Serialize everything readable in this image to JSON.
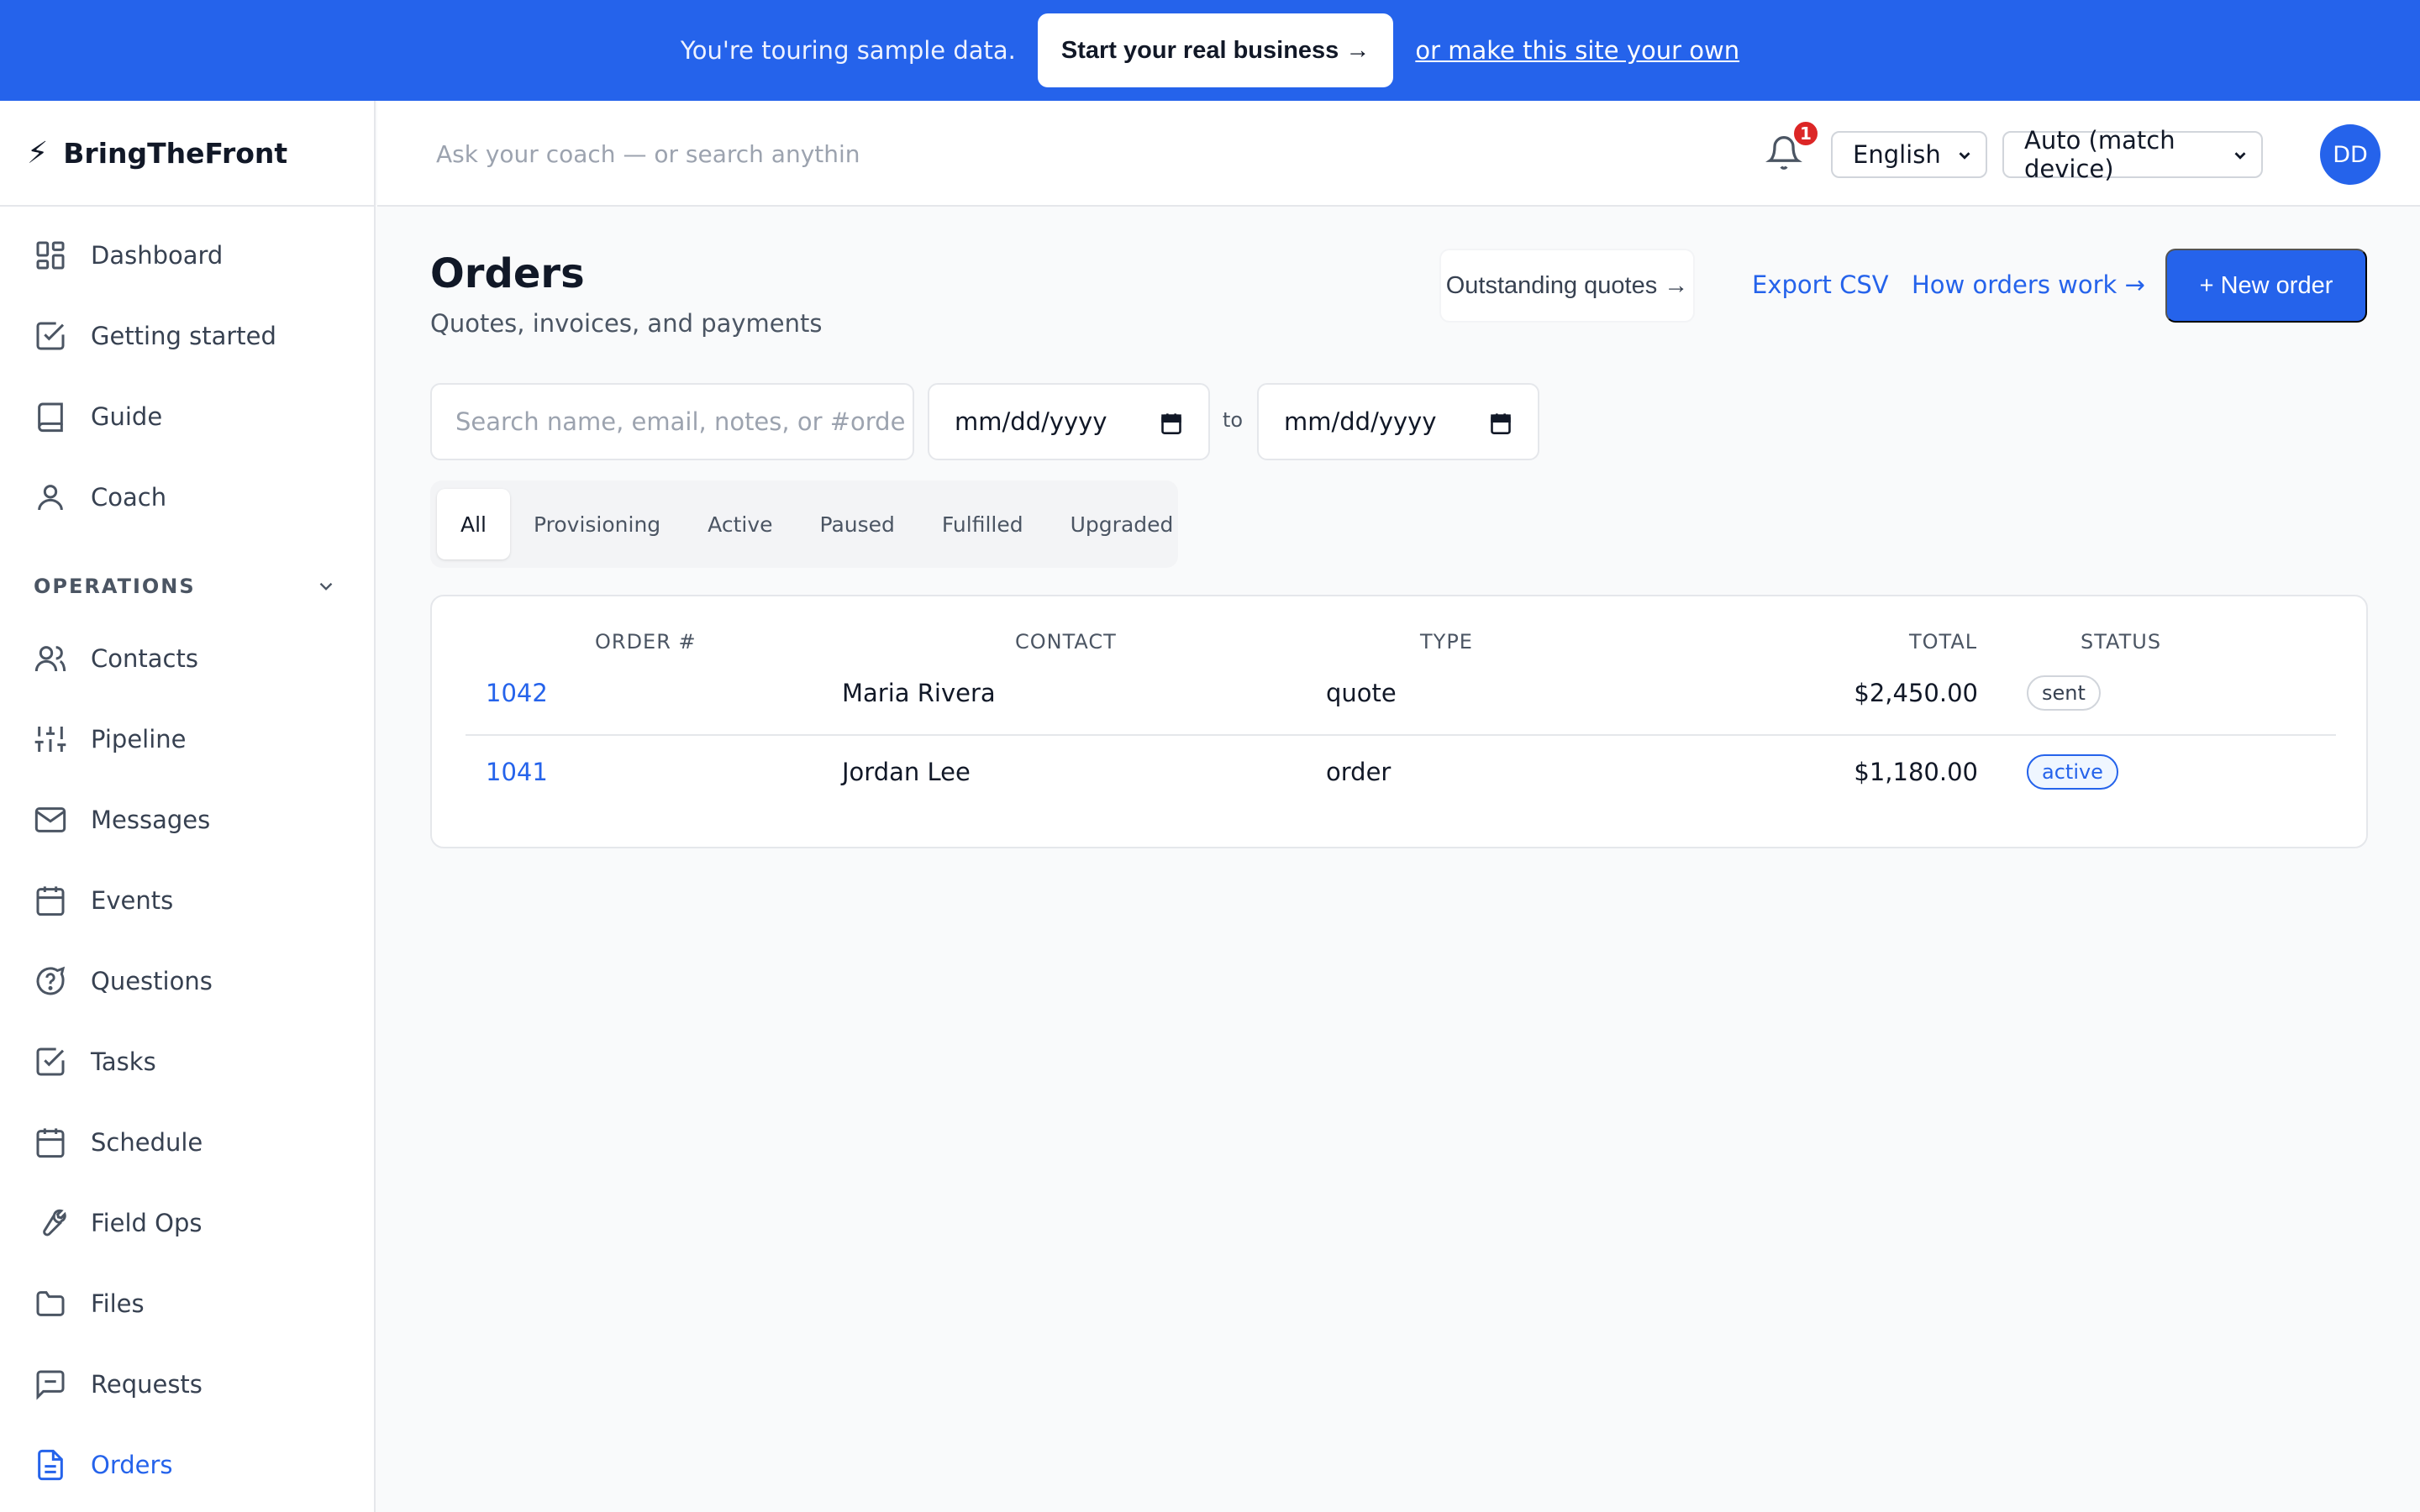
{
  "banner": {
    "text": "You're touring sample data.",
    "cta_label": "Start your real business →",
    "link_label": "or make this site your own"
  },
  "brand": {
    "name": "BringTheFront"
  },
  "sidebar": {
    "items_top": [
      {
        "label": "Dashboard",
        "icon": "dashboard-icon"
      },
      {
        "label": "Getting started",
        "icon": "checkbox-icon"
      },
      {
        "label": "Guide",
        "icon": "book-icon"
      },
      {
        "label": "Coach",
        "icon": "user-icon"
      }
    ],
    "section_label": "OPERATIONS",
    "items_ops": [
      {
        "label": "Contacts",
        "icon": "users-icon"
      },
      {
        "label": "Pipeline",
        "icon": "sliders-icon"
      },
      {
        "label": "Messages",
        "icon": "mail-icon"
      },
      {
        "label": "Events",
        "icon": "calendar-icon"
      },
      {
        "label": "Questions",
        "icon": "question-bubble-icon"
      },
      {
        "label": "Tasks",
        "icon": "checkbox-icon"
      },
      {
        "label": "Schedule",
        "icon": "calendar-icon"
      },
      {
        "label": "Field Ops",
        "icon": "wrench-icon"
      },
      {
        "label": "Files",
        "icon": "folder-icon"
      },
      {
        "label": "Requests",
        "icon": "message-square-icon"
      },
      {
        "label": "Orders",
        "icon": "document-icon",
        "active": true
      }
    ]
  },
  "header": {
    "search_placeholder": "Ask your coach — or search anythin",
    "notifications_count": "1",
    "language": "English",
    "theme": "Auto (match device)",
    "avatar_initials": "DD"
  },
  "page": {
    "title": "Orders",
    "subtitle": "Quotes, invoices, and payments",
    "outstanding_label": "Outstanding quotes →",
    "export_label": "Export CSV",
    "how_label": "How orders work →",
    "new_order_label": "+ New order"
  },
  "filters": {
    "search_placeholder": "Search name, email, notes, or #orde",
    "date_from": "mm/dd/yyyy",
    "date_separator": "to",
    "date_to": "mm/dd/yyyy",
    "tabs": [
      "All",
      "Provisioning",
      "Active",
      "Paused",
      "Fulfilled",
      "Upgraded"
    ],
    "active_tab": "All"
  },
  "table": {
    "headers": {
      "order": "ORDER #",
      "contact": "CONTACT",
      "type": "TYPE",
      "total": "TOTAL",
      "status": "STATUS"
    },
    "rows": [
      {
        "order": "1042",
        "contact": "Maria Rivera",
        "type": "quote",
        "total": "$2,450.00",
        "status": "sent"
      },
      {
        "order": "1041",
        "contact": "Jordan Lee",
        "type": "order",
        "total": "$1,180.00",
        "status": "active"
      }
    ]
  },
  "colors": {
    "accent": "#2563eb",
    "badge_red": "#dc2626"
  }
}
